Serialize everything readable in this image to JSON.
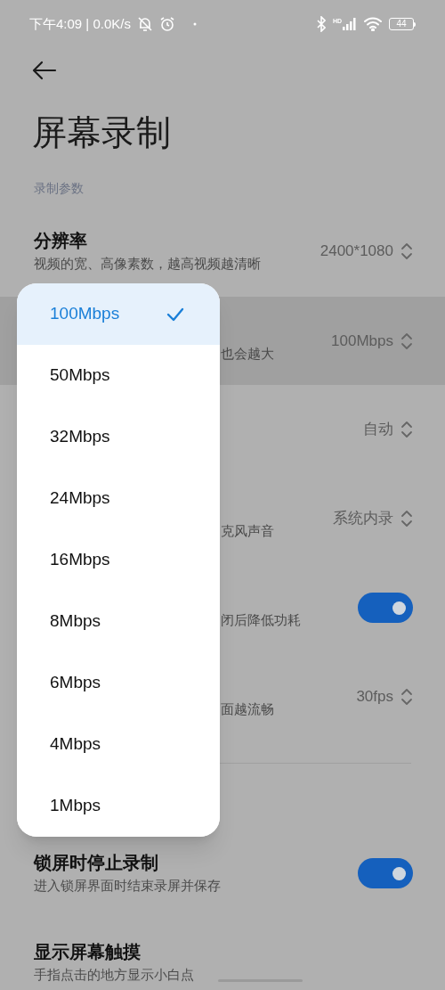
{
  "status_bar": {
    "time": "下午4:09 | 0.0K/s",
    "hd": "HD",
    "battery": "44"
  },
  "header": {
    "title": "屏幕录制"
  },
  "sections": [
    {
      "label": "录制参数",
      "rows": [
        {
          "kind": "select",
          "title": "分辨率",
          "subtitle": "视频的宽、高像素数，越高视频越清晰",
          "value": "2400*1080",
          "expanded": false
        },
        {
          "kind": "select",
          "subtitle": "也会越大",
          "value": "100Mbps",
          "expanded": true
        },
        {
          "kind": "select",
          "value": "自动",
          "expanded": false
        },
        {
          "kind": "select",
          "subtitle": "克风声音",
          "value": "系统内录",
          "expanded": false
        },
        {
          "kind": "toggle",
          "subtitle": "闭后降低功耗",
          "on": true,
          "expanded": false
        },
        {
          "kind": "select",
          "subtitle": "面越流畅",
          "value": "30fps",
          "expanded": false
        }
      ]
    },
    {
      "rows": [
        {
          "kind": "toggle",
          "title": "锁屏时停止录制",
          "subtitle": "进入锁屏界面时结束录屏并保存",
          "on": true,
          "expanded": false
        },
        {
          "kind": "text",
          "title": "显示屏幕触摸",
          "subtitle": "手指点击的地方显示小白点",
          "expanded": false
        }
      ]
    }
  ],
  "menu": [
    {
      "label": "100Mbps",
      "selected": true
    },
    {
      "label": "50Mbps",
      "selected": false
    },
    {
      "label": "32Mbps",
      "selected": false
    },
    {
      "label": "24Mbps",
      "selected": false
    },
    {
      "label": "16Mbps",
      "selected": false
    },
    {
      "label": "8Mbps",
      "selected": false
    },
    {
      "label": "6Mbps",
      "selected": false
    },
    {
      "label": "4Mbps",
      "selected": false
    },
    {
      "label": "1Mbps",
      "selected": false
    }
  ]
}
